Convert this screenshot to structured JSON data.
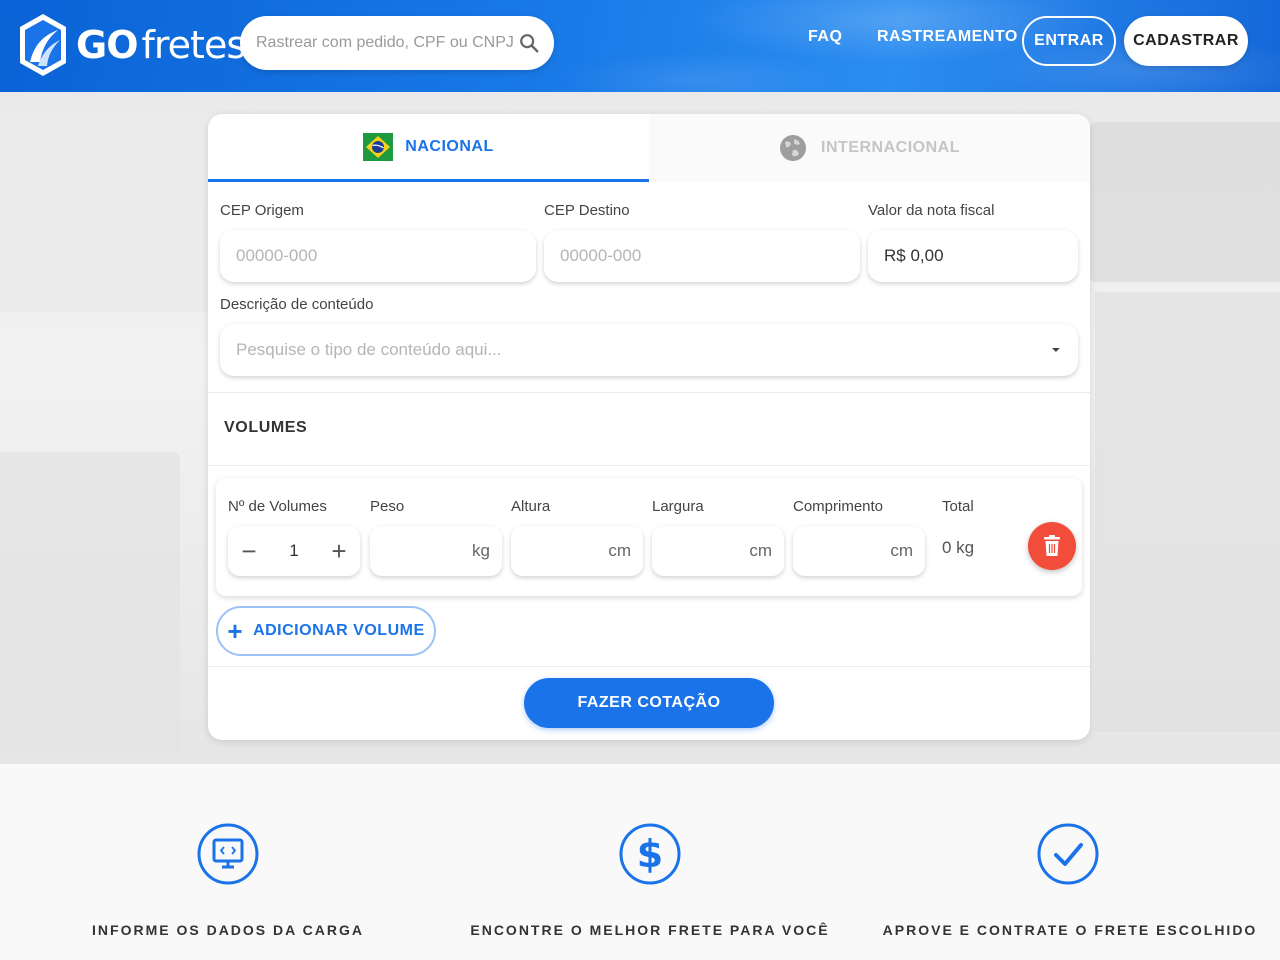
{
  "header": {
    "logo": {
      "part1": "GO",
      "part2": "fretes"
    },
    "search_placeholder": "Rastrear com pedido, CPF ou CNPJ",
    "nav": {
      "faq": "FAQ",
      "rastreamento": "RASTREAMENTO"
    },
    "login_label": "ENTRAR",
    "signup_label": "CADASTRAR"
  },
  "tabs": {
    "nacional": "NACIONAL",
    "internacional": "INTERNACIONAL",
    "active": "nacional"
  },
  "form": {
    "cep_origem_label": "CEP Origem",
    "cep_origem_placeholder": "00000-000",
    "cep_destino_label": "CEP Destino",
    "cep_destino_placeholder": "00000-000",
    "valor_nf_label": "Valor da nota fiscal",
    "valor_nf_value": "R$ 0,00",
    "descricao_label": "Descrição de conteúdo",
    "descricao_placeholder": "Pesquise o tipo de conteúdo aqui..."
  },
  "volumes": {
    "title": "VOLUMES",
    "labels": {
      "quantidade": "Nº de Volumes",
      "peso": "Peso",
      "altura": "Altura",
      "largura": "Largura",
      "comprimento": "Comprimento",
      "total": "Total"
    },
    "quantidade_value": "1",
    "units": {
      "peso": "kg",
      "altura": "cm",
      "largura": "cm",
      "comprimento": "cm"
    },
    "total_value": "0 kg",
    "add_label": "ADICIONAR VOLUME"
  },
  "quote_button": "FAZER COTAÇÃO",
  "steps": [
    {
      "icon": "monitor-icon",
      "text": "INFORME OS DADOS DA CARGA"
    },
    {
      "icon": "dollar-icon",
      "text": "ENCONTRE O MELHOR FRETE PARA VOCÊ"
    },
    {
      "icon": "checkmark-icon",
      "text": "APROVE E CONTRATE O FRETE ESCOLHIDO"
    }
  ],
  "colors": {
    "primary": "#1a73e8",
    "header": "#0a63d6",
    "delete": "#f24c3a"
  }
}
